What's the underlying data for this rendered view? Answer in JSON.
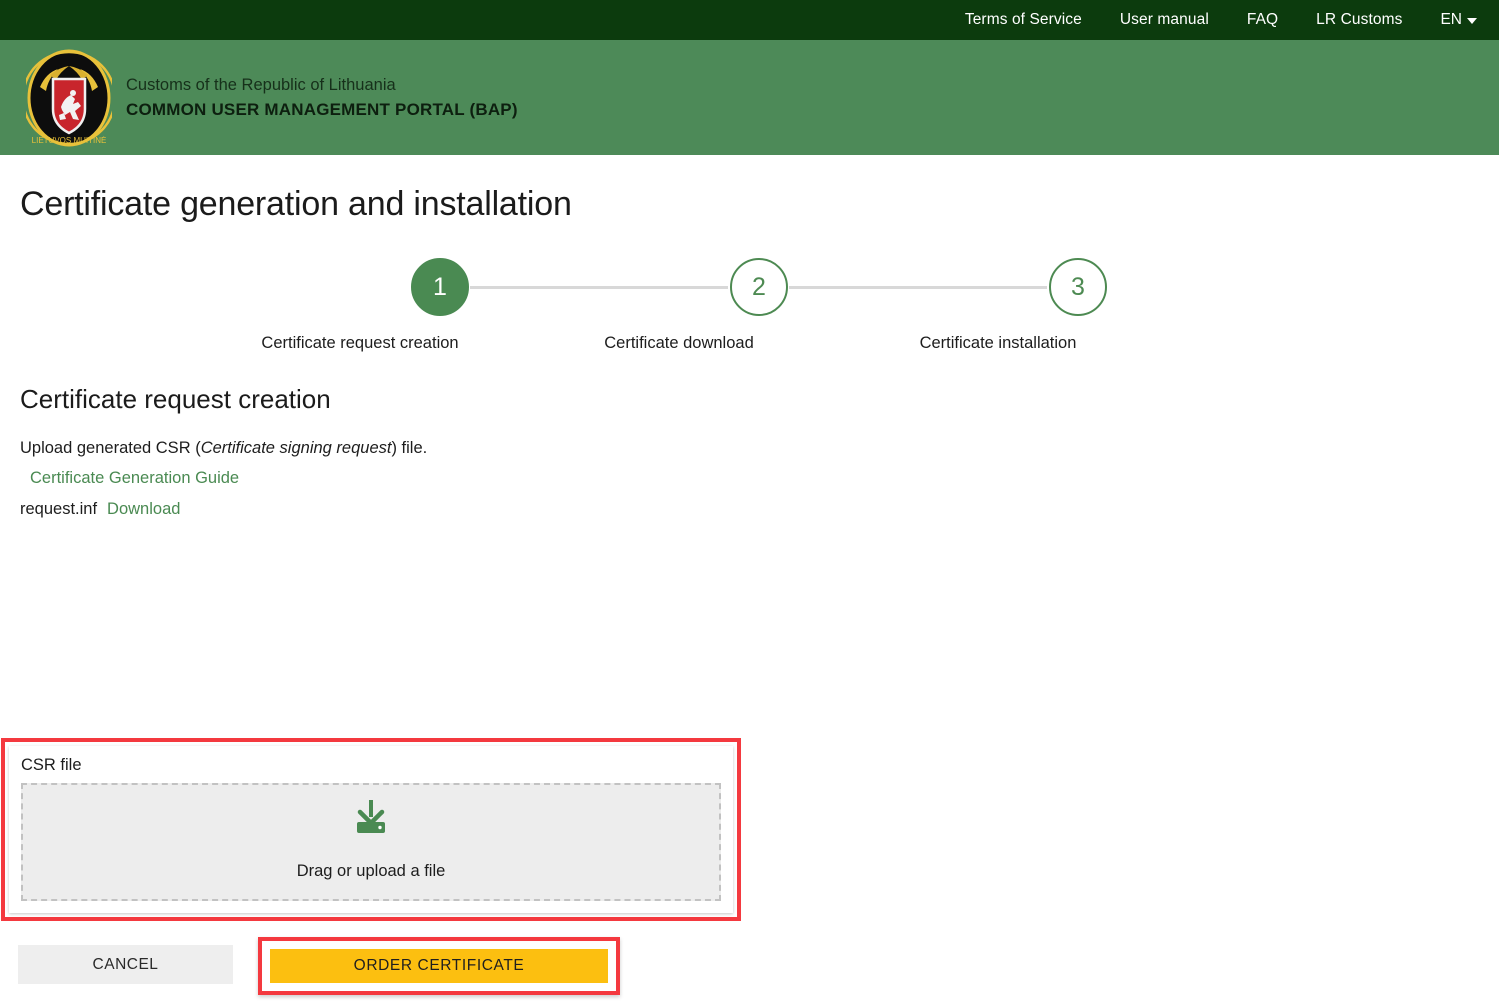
{
  "topbar": {
    "links": [
      {
        "label": "Terms of Service"
      },
      {
        "label": "User manual"
      },
      {
        "label": "FAQ"
      },
      {
        "label": "LR Customs"
      }
    ],
    "language": "EN",
    "caret_icon": "chevron-down-icon"
  },
  "brand": {
    "logo_icon": "lithuania-customs-emblem",
    "logo_ring_text": "LIETUVOS MUITINĖ",
    "subtitle": "Customs of the Republic of Lithuania",
    "title": "COMMON USER MANAGEMENT PORTAL (BAP)"
  },
  "page": {
    "title": "Certificate generation and installation"
  },
  "stepper": {
    "steps": [
      {
        "number": "1",
        "label": "Certificate request creation",
        "state": "active"
      },
      {
        "number": "2",
        "label": "Certificate download",
        "state": "inactive"
      },
      {
        "number": "3",
        "label": "Certificate installation",
        "state": "inactive"
      }
    ]
  },
  "section": {
    "title": "Certificate request creation",
    "instruction_prefix": "Upload generated CSR (",
    "instruction_italic": "Certificate signing request",
    "instruction_suffix": ") file.",
    "guide_link": "Certificate Generation Guide",
    "file_name": "request.inf",
    "download_link": "Download"
  },
  "upload": {
    "field_label": "CSR file",
    "icon": "download-tray-icon",
    "drop_text": "Drag or upload a file"
  },
  "actions": {
    "cancel_label": "CANCEL",
    "order_label": "ORDER CERTIFICATE"
  },
  "colors": {
    "topbar_bg": "#0c3b0d",
    "brandbar_bg": "#4d8a58",
    "accent_green": "#4a8a52",
    "highlight_red": "#f4393f",
    "order_yellow": "#fcbf10",
    "cancel_gray": "#eeeeee"
  }
}
